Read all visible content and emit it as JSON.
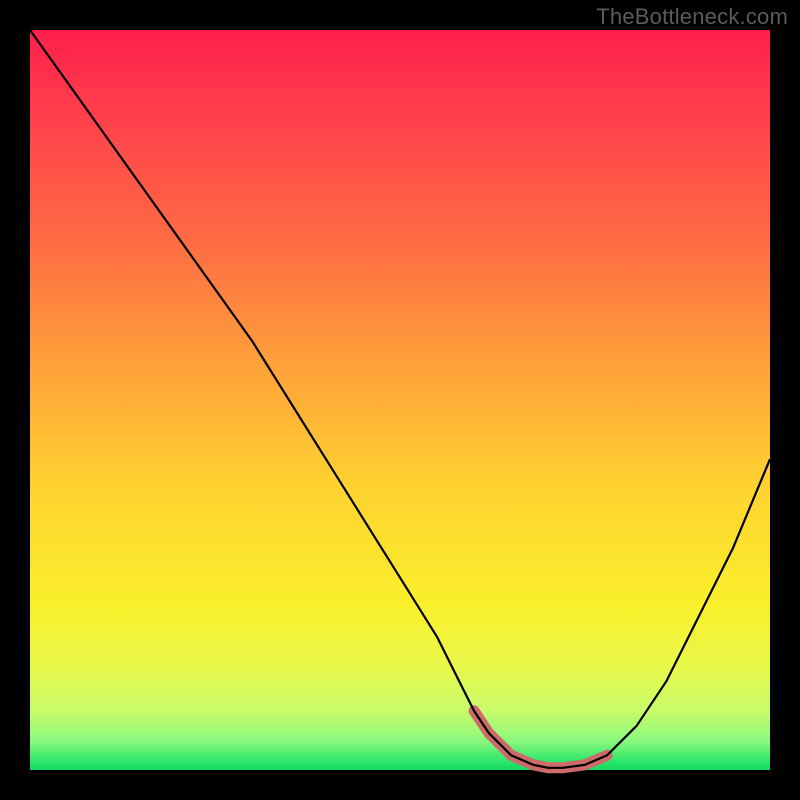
{
  "watermark": "TheBottleneck.com",
  "colors": {
    "frame_bg": "#000000",
    "gradient_top": "#ff1f4a",
    "gradient_bottom": "#13d85f",
    "curve": "#000000",
    "valley_highlight": "#cc6b69"
  },
  "chart_data": {
    "type": "line",
    "title": "",
    "xlabel": "",
    "ylabel": "",
    "xlim": [
      0,
      100
    ],
    "ylim": [
      0,
      100
    ],
    "grid": false,
    "series": [
      {
        "name": "bottleneck-curve",
        "x": [
          0,
          5,
          10,
          15,
          20,
          25,
          30,
          35,
          40,
          45,
          50,
          55,
          58,
          60,
          62,
          65,
          68,
          70,
          72,
          75,
          78,
          82,
          86,
          90,
          95,
          100
        ],
        "y": [
          100,
          93,
          86,
          79,
          72,
          65,
          58,
          50,
          42,
          34,
          26,
          18,
          12,
          8,
          5,
          2,
          0.7,
          0.3,
          0.3,
          0.7,
          2,
          6,
          12,
          20,
          30,
          42
        ]
      }
    ],
    "annotations": [
      {
        "name": "valley-highlight",
        "x_range": [
          60,
          78
        ],
        "note": "thick salmon segment marking the minimum region"
      }
    ]
  }
}
